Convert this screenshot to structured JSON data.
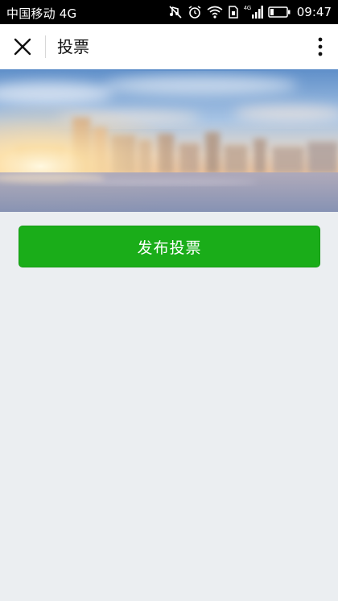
{
  "status_bar": {
    "carrier": "中国移动 4G",
    "network_badge": "4G",
    "time": "09:47",
    "icons": [
      "mute-icon",
      "alarm-icon",
      "wifi-icon",
      "sim-icon",
      "signal-icon",
      "battery-icon"
    ]
  },
  "nav": {
    "title": "投票",
    "close_icon": "close-icon",
    "more_icon": "more-vertical-icon"
  },
  "banner": {
    "description_icon": "city-skyline-banner"
  },
  "main": {
    "publish_label": "发布投票"
  },
  "colors": {
    "primary_green": "#1aad19",
    "page_background": "#ebeef1",
    "nav_background": "#ffffff",
    "status_bar_background": "#000000"
  }
}
